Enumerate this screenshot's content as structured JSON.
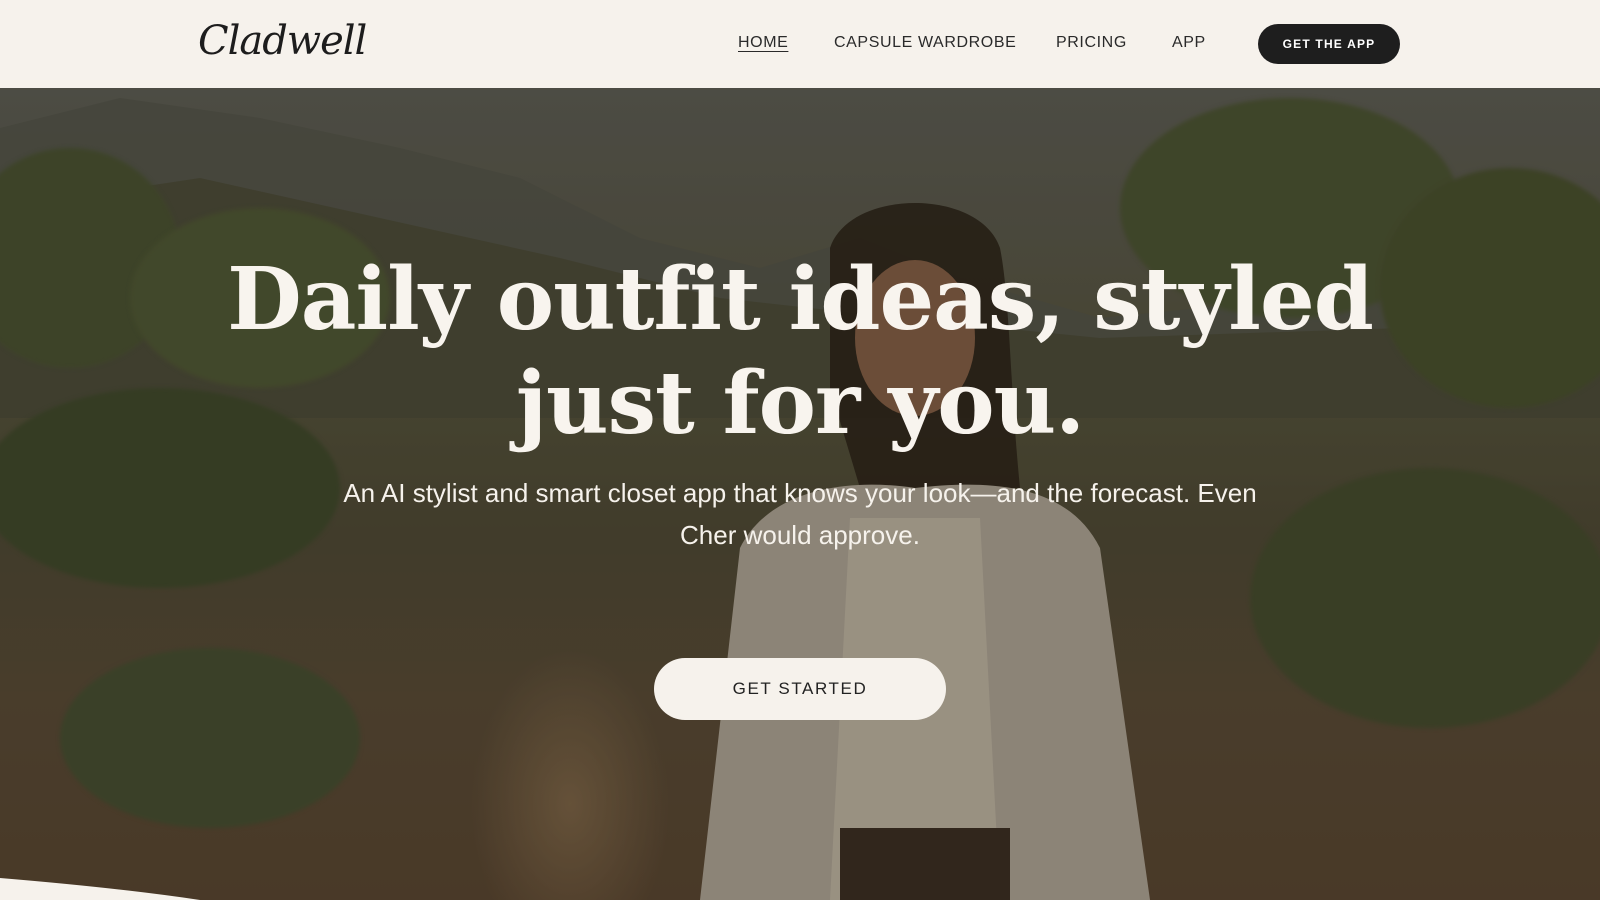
{
  "brand": {
    "name": "Cladwell"
  },
  "nav": {
    "items": [
      {
        "label": "HOME",
        "active": true
      },
      {
        "label": "CAPSULE WARDROBE",
        "active": false
      },
      {
        "label": "PRICING",
        "active": false
      },
      {
        "label": "APP",
        "active": false
      }
    ],
    "cta_label": "GET THE APP"
  },
  "hero": {
    "headline_line1": "Daily outfit ideas, styled",
    "headline_line2": "just for you.",
    "subtitle_line1": "An AI stylist and smart closet app that knows your look—and the forecast. Even",
    "subtitle_line2": "Cher would approve.",
    "cta_label": "GET STARTED"
  },
  "colors": {
    "background": "#f6f2ec",
    "dark_button": "#1e1e1e",
    "hero_text": "#f8f4ee"
  }
}
